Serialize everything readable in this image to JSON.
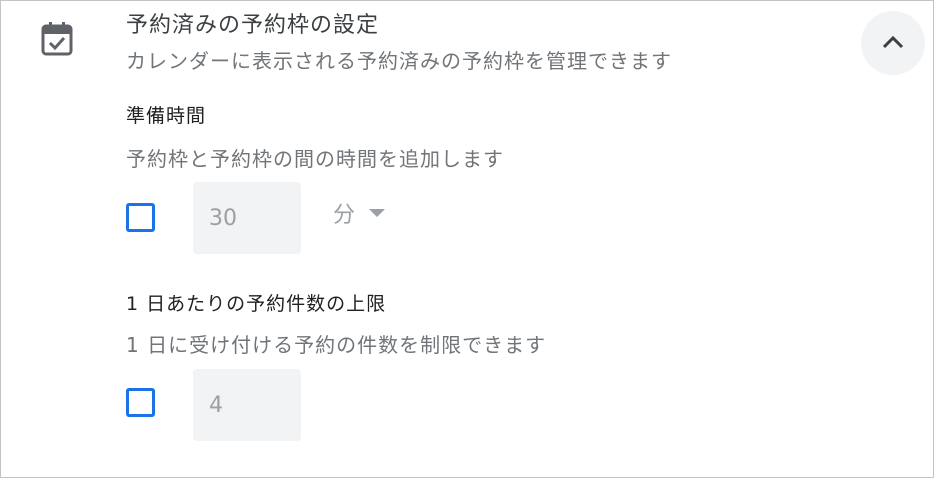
{
  "header": {
    "title": "予約済みの予約枠の設定",
    "subtitle": "カレンダーに表示される予約済みの予約枠を管理できます"
  },
  "buffer": {
    "title": "準備時間",
    "description": "予約枠と予約枠の間の時間を追加します",
    "checked": false,
    "value": "30",
    "unit": "分"
  },
  "daily_limit": {
    "title": "1 日あたりの予約件数の上限",
    "description": "1 日に受け付ける予約の件数を制限できます",
    "checked": false,
    "value": "4"
  },
  "colors": {
    "accent": "#1a73e8",
    "icon": "#5f6368",
    "field_bg": "#f1f3f4",
    "disabled_text": "#9aa0a6"
  }
}
